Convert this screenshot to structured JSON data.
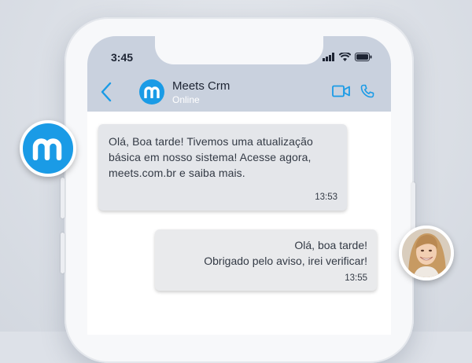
{
  "status_bar": {
    "time": "3:45"
  },
  "header": {
    "contact_name": "Meets Crm",
    "contact_status": "Online"
  },
  "messages": [
    {
      "direction": "incoming",
      "text": "Olá, Boa tarde! Tivemos uma atualização básica em nosso sistema! Acesse agora, meets.com.br e saiba mais.",
      "time": "13:53"
    },
    {
      "direction": "outgoing",
      "text_lines": [
        "Olá, boa tarde!",
        "Obrigado pelo aviso, irei verificar!"
      ],
      "time": "13:55"
    }
  ],
  "icons": [
    "back-arrow-icon",
    "video-call-icon",
    "phone-call-icon",
    "signal-icon",
    "wifi-icon",
    "battery-icon",
    "meets-logo-icon"
  ],
  "colors": {
    "brand": "#1a9be6",
    "header_bg": "#c9d1de",
    "bubble_bg": "#e4e6ea",
    "page_bg": "#dde1e8"
  }
}
